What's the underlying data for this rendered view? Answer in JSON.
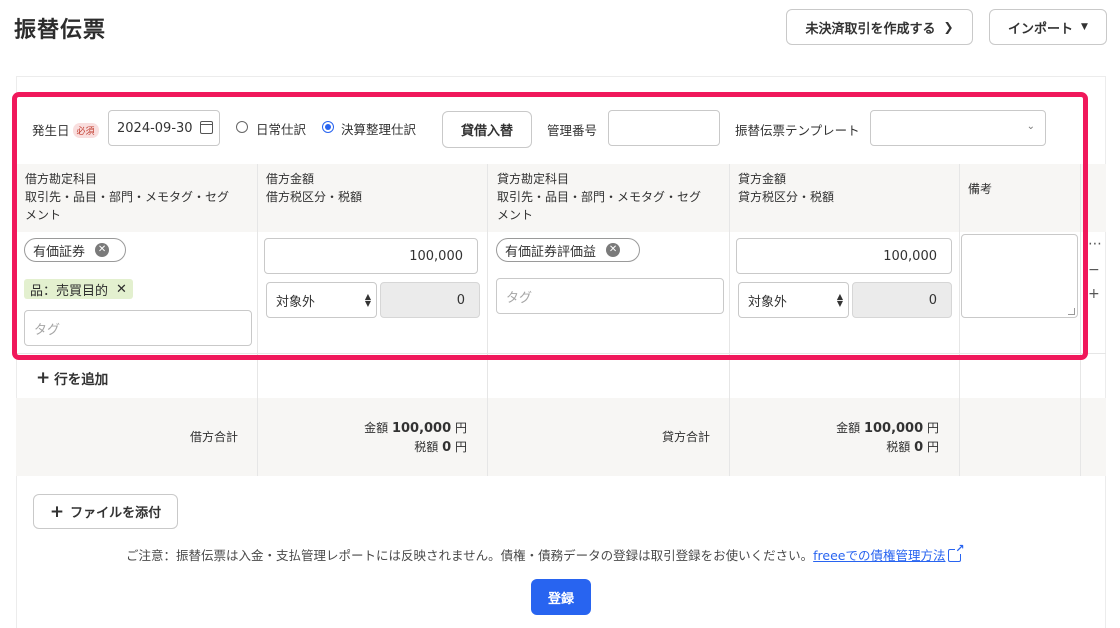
{
  "header": {
    "title": "振替伝票",
    "unsettled_button": "未決済取引を作成する",
    "import_button": "インポート"
  },
  "form": {
    "date_label": "発生日",
    "required_badge": "必須",
    "date_value": "2024-09-30",
    "radio_normal": "日常仕訳",
    "radio_closing": "決算整理仕訳",
    "selected_radio": "決算整理仕訳",
    "swap_button": "貸借入替",
    "mgmt_no_label": "管理番号",
    "mgmt_no_value": "",
    "template_label": "振替伝票テンプレート",
    "template_value": ""
  },
  "table": {
    "headers": [
      "借方勘定科目\n取引先・品目・部門・メモタグ・セグ\nメント",
      "借方金額\n借方税区分・税額",
      "貸方勘定科目\n取引先・品目・部門・メモタグ・セグ\nメント",
      "貸方金額\n貸方税区分・税額",
      "備考"
    ],
    "row": {
      "debit_account": "有価証券",
      "debit_item_tag": "品：売買目的",
      "debit_tag_placeholder": "タグ",
      "debit_amount": "100,000",
      "debit_tax_category": "対象外",
      "debit_tax_amount": "0",
      "credit_account": "有価証券評価益",
      "credit_tag_placeholder": "タグ",
      "credit_amount": "100,000",
      "credit_tax_category": "対象外",
      "credit_tax_amount": "0",
      "notes": ""
    },
    "add_row": "行を追加"
  },
  "totals": {
    "debit_label": "借方合計",
    "credit_label": "貸方合計",
    "amount_prefix": "金額",
    "tax_prefix": "税額",
    "debit_amount": "100,000",
    "debit_tax": "0",
    "credit_amount": "100,000",
    "credit_tax": "0",
    "unit": "円"
  },
  "footer": {
    "attach_button": "ファイルを添付",
    "notice": "ご注意：振替伝票は入金・支払管理レポートには反映されません。債権・債務データの登録は取引登録をお使いください。",
    "notice_link": "freeeでの債権管理方法",
    "submit_button": "登録"
  },
  "colors": {
    "accent": "#2864f0",
    "highlight": "#f0185b",
    "item_tag_bg": "#e3f0cf"
  }
}
